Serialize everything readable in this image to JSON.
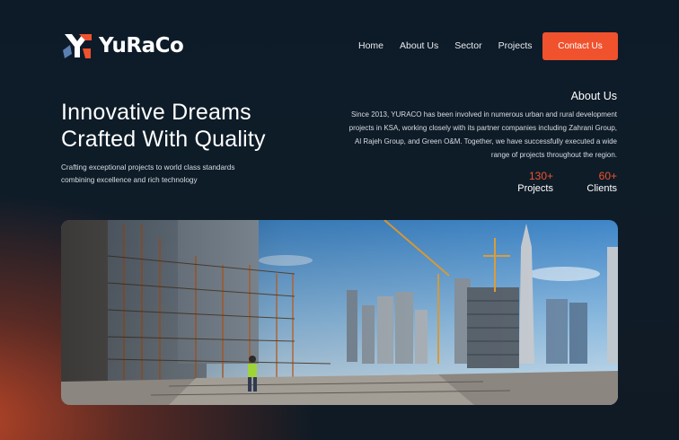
{
  "brand": {
    "name": "YuRaCo",
    "accent": "#f0522d",
    "logo_blue": "#5b7fb0",
    "bg": "#0e1a26"
  },
  "nav": {
    "items": [
      "Home",
      "About Us",
      "Sector",
      "Projects"
    ],
    "contact_label": "Contact Us"
  },
  "hero": {
    "title_line1": "Innovative Dreams",
    "title_line2": "Crafted With Quality",
    "subtitle": "Crafting exceptional projects to world class standards combining excellence and rich technology"
  },
  "about": {
    "title": "About Us",
    "text": "Since 2013, YURACO has been involved in numerous urban and rural development projects in KSA, working closely with its partner companies including Zahrani Group, Al Rajeh Group, and Green O&M. Together, we have successfully executed a wide range of projects throughout the region.",
    "stats": [
      {
        "value": "130+",
        "label": "Projects"
      },
      {
        "value": "60+",
        "label": "Clients"
      }
    ]
  },
  "image": {
    "subject": "construction-site-photo"
  }
}
